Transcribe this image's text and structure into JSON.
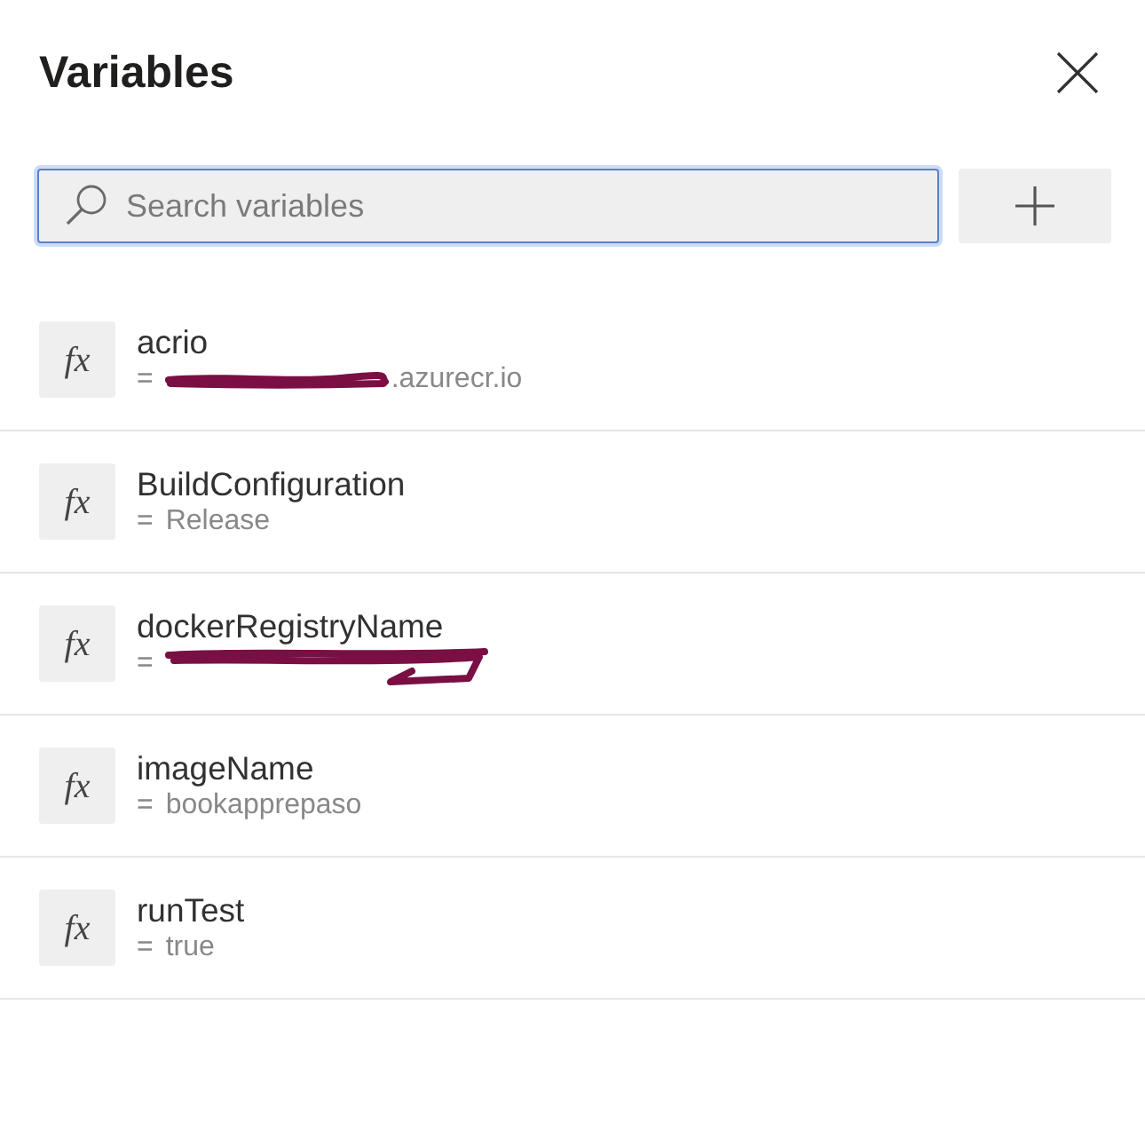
{
  "panel": {
    "title": "Variables"
  },
  "search": {
    "placeholder": "Search variables",
    "focused": true
  },
  "variables": [
    {
      "icon": "fx",
      "name": "acrio",
      "value_prefix": "=",
      "redacted": true,
      "value": ".azurecr.io"
    },
    {
      "icon": "fx",
      "name": "BuildConfiguration",
      "value_prefix": "=",
      "redacted": false,
      "value": "Release"
    },
    {
      "icon": "fx",
      "name": "dockerRegistryName",
      "value_prefix": "=",
      "redacted": true
    },
    {
      "icon": "fx",
      "name": "imageName",
      "value_prefix": "=",
      "redacted": false,
      "value": "bookapprepaso"
    },
    {
      "icon": "fx",
      "name": "runTest",
      "value_prefix": "=",
      "redacted": false,
      "value": "true"
    }
  ]
}
